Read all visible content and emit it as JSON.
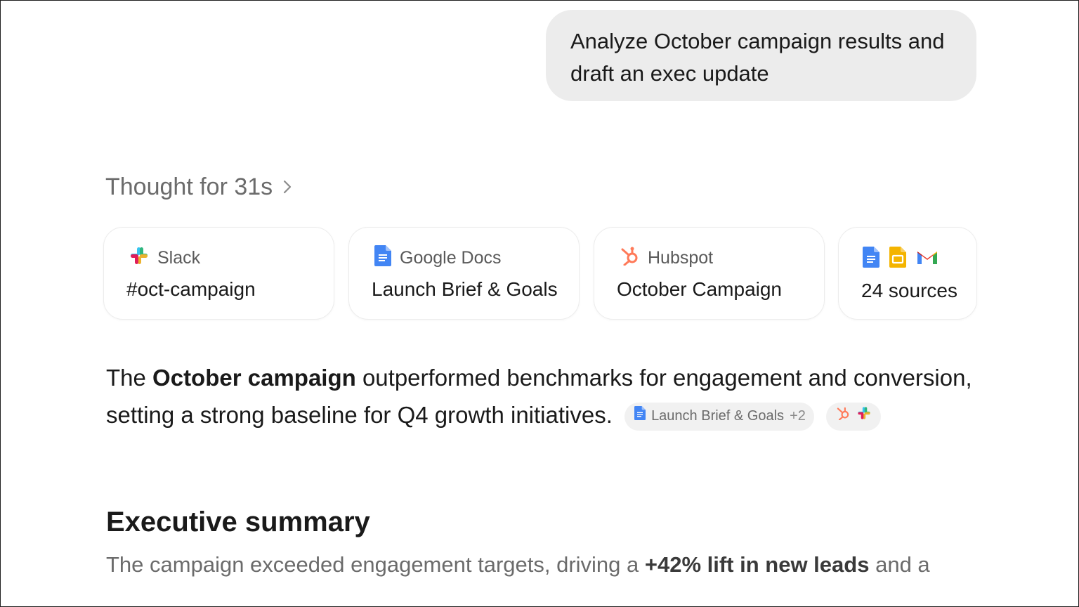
{
  "user_message": "Analyze October campaign results and draft an exec update",
  "thought": {
    "label": "Thought for 31s"
  },
  "source_cards": [
    {
      "app": "Slack",
      "title": "#oct-campaign",
      "icon": "slack-icon"
    },
    {
      "app": "Google Docs",
      "title": "Launch Brief & Goals",
      "icon": "google-docs-icon"
    },
    {
      "app": "Hubspot",
      "title": "October Campaign",
      "icon": "hubspot-icon"
    },
    {
      "icons": [
        "google-docs-icon",
        "google-slides-icon",
        "gmail-icon"
      ],
      "title": "24 sources"
    }
  ],
  "answer": {
    "prefix": "The ",
    "bold": "October campaign",
    "suffix": " outperformed benchmarks for engagement and conversion, setting a strong baseline for Q4 growth initiatives.",
    "citation": {
      "label": "Launch Brief & Goals",
      "count": "+2"
    }
  },
  "summary": {
    "heading": "Executive summary",
    "prefix": "The campaign exceeded engagement targets, driving a ",
    "bold": "+42% lift in new leads",
    "suffix": " and a"
  },
  "colors": {
    "bubble": "#ececec",
    "docs_blue": "#4285f4",
    "hubspot_orange": "#ff7a59",
    "slides_yellow": "#f4b400"
  }
}
